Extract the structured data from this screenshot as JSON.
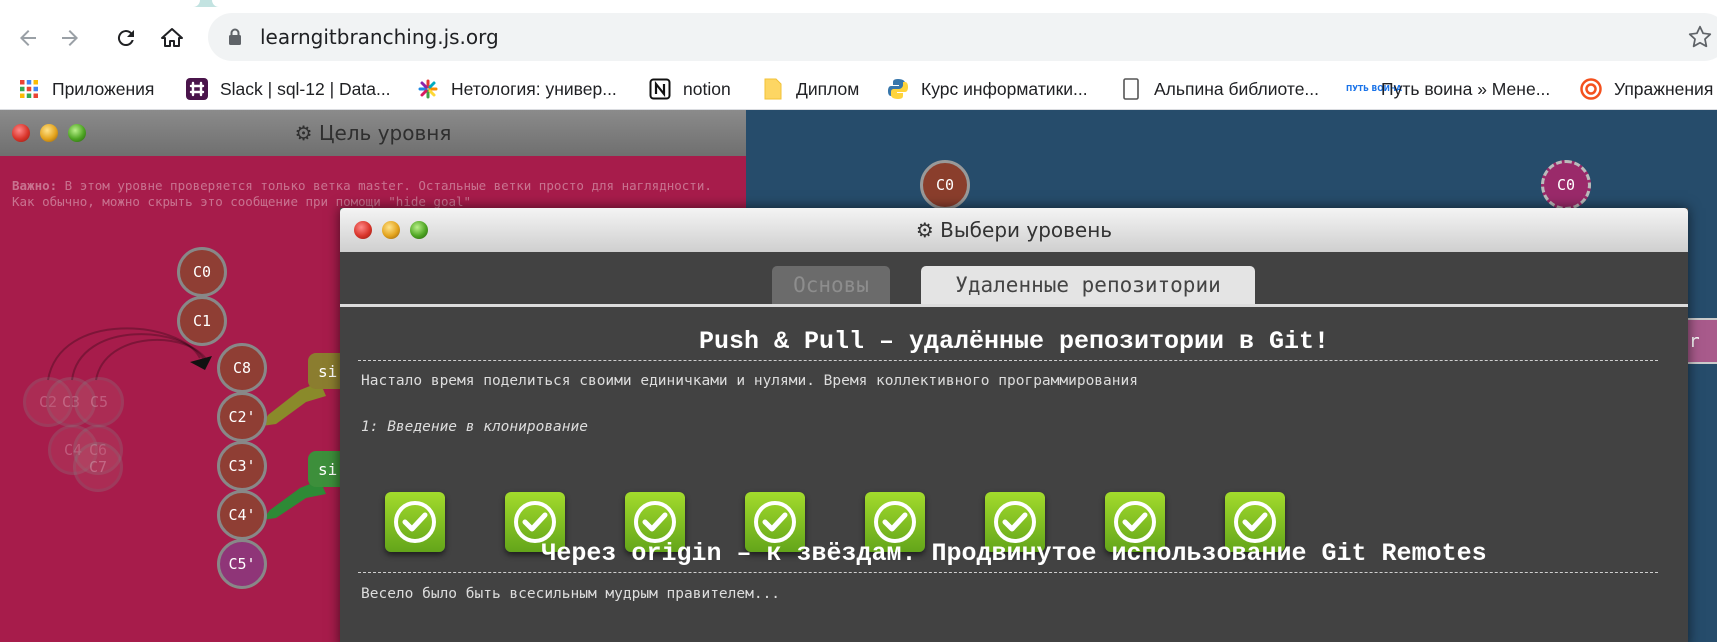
{
  "browser": {
    "url": "learngitbranching.js.org",
    "bookmarks": [
      {
        "label": "Приложения",
        "icon": "apps-grid-icon"
      },
      {
        "label": "Slack | sql-12 | Data...",
        "icon": "slack-icon"
      },
      {
        "label": "Нетология: универ...",
        "icon": "netology-icon"
      },
      {
        "label": "notion",
        "icon": "notion-icon"
      },
      {
        "label": "Диплом",
        "icon": "folder-icon"
      },
      {
        "label": "Курс информатики...",
        "icon": "python-icon"
      },
      {
        "label": "Альпина библиоте...",
        "icon": "document-icon"
      },
      {
        "label": "Путь воина » Мене...",
        "icon": "put-voina-icon"
      },
      {
        "label": "Упражнения",
        "icon": "target-icon"
      }
    ],
    "putvoina_logo": "ПУТЬ ВОИНА"
  },
  "goal_window": {
    "title": "Цель уровня",
    "note_bold": "Важно:",
    "note_text": " В этом уровне проверяется только ветка master. Остальные ветки просто для наглядности. Как обычно, можно скрыть это сообщение при помощи \"hide goal\"",
    "nodes": {
      "c0": "C0",
      "c1": "C1",
      "c8": "C8",
      "c2p": "C2'",
      "c3p": "C3'",
      "c4p": "C4'",
      "c5p": "C5'",
      "c2": "C2",
      "c3": "C3",
      "c5": "C5",
      "c4": "C4",
      "c6": "C6",
      "c7": "C7"
    },
    "branch_tags": [
      "si",
      "si"
    ]
  },
  "remote_area": {
    "node_left": "C0",
    "node_right": "C0",
    "tag_partial": "er"
  },
  "level_window": {
    "title": "Выбери уровень",
    "tabs": {
      "basic": "Основы",
      "remote": "Удаленные репозитории"
    },
    "sequence1": {
      "title": "Push & Pull – удалённые репозитории в Git!",
      "about": "Настало время поделиться своими единичками и нулями. Время коллективного программирования",
      "level_name": "1: Введение в клонирование",
      "level_count": 8,
      "completed": true
    },
    "sequence2": {
      "title": "Через origin – к звёздам. Продвинутое использование Git Remotes",
      "about": "Весело было быть всесильным мудрым правителем..."
    }
  }
}
